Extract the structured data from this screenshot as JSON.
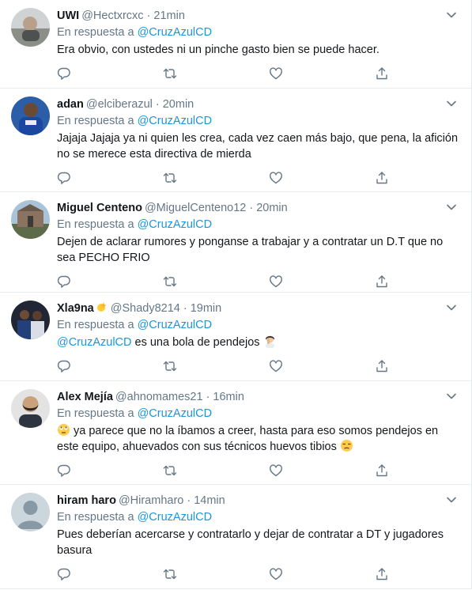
{
  "reply_prefix": "En respuesta a",
  "tweets": [
    {
      "name": "UWI",
      "handle": "@Hectxrcxc",
      "time": "21min",
      "reply_to": "@CruzAzulCD",
      "text": "Era obvio, con ustedes ni un pinche gasto bien se puede hacer."
    },
    {
      "name": "adan",
      "handle": "@elciberazul",
      "time": "20min",
      "reply_to": "@CruzAzulCD",
      "text": "Jajaja Jajaja ya ni quien les crea, cada vez caen más bajo, que pena, la afición no se merece esta directiva de mierda"
    },
    {
      "name": "Miguel Centeno",
      "handle": "@MiguelCenteno12",
      "time": "20min",
      "reply_to": "@CruzAzulCD",
      "text": "Dejen de aclarar rumores y ponganse a trabajar y a contratar un D.T que no sea PECHO FRIO"
    },
    {
      "name": "Xla9na",
      "handle": "@Shady8214",
      "time": "19min",
      "reply_to": "@CruzAzulCD",
      "mention": "@CruzAzulCD",
      "text": " es una bola de pendejos "
    },
    {
      "name": "Alex Mejía",
      "handle": "@ahnomames21",
      "time": "16min",
      "reply_to": "@CruzAzulCD",
      "text": " ya parece que no la íbamos a creer, hasta para eso somos pendejos en este equipo, ahuevados con sus técnicos huevos tibios "
    },
    {
      "name": "hiram haro",
      "handle": "@Hiramharo",
      "time": "14min",
      "reply_to": "@CruzAzulCD",
      "text": "Pues deberían  acercarse y contratarlo y dejar de contratar a DT y jugadores basura"
    }
  ],
  "colors": {
    "link": "#1b95e0",
    "muted": "#657786",
    "text": "#14171a",
    "divider": "#e6ecf0"
  },
  "icons": [
    "caret-down-icon",
    "reply-icon",
    "retweet-icon",
    "like-icon",
    "share-icon",
    "sparkle-emoji",
    "facepalm-emoji",
    "rolling-eyes-emoji",
    "unamused-emoji"
  ]
}
